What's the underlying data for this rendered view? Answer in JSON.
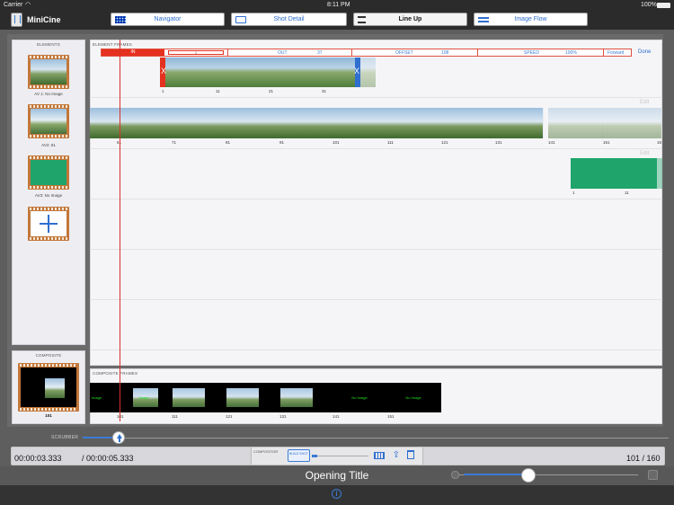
{
  "status": {
    "carrier": "Carrier",
    "time": "8:11 PM",
    "battery": "100%"
  },
  "app": {
    "title": "MiniCine"
  },
  "tabs": [
    {
      "label": "Navigator",
      "icon": "grid-icon"
    },
    {
      "label": "Shot Detail",
      "icon": "play-box-icon"
    },
    {
      "label": "Line Up",
      "icon": "lineup-icon",
      "active": true
    },
    {
      "label": "Image Flow",
      "icon": "flow-icon"
    }
  ],
  "elements": {
    "caption": "ELEMENTS",
    "items": [
      {
        "caption": "AV 1: No Image",
        "kind": "landscape"
      },
      {
        "caption": "AV2: 61",
        "kind": "landscape"
      },
      {
        "caption": "AV3: No Image",
        "kind": "green"
      },
      {
        "caption": "",
        "kind": "add"
      }
    ]
  },
  "composite": {
    "caption": "COMPOSITE",
    "frame": "101"
  },
  "elementFrames": {
    "caption": "ELEMENT FRAMES",
    "controls": {
      "in_label": "IN",
      "in_value": "1",
      "out_label": "OUT",
      "out_value": "37",
      "offset_label": "OFFSET",
      "offset_value": "108",
      "speed_label": "SPEED",
      "speed_value": "100%",
      "direction": "Forward",
      "done": "Done"
    },
    "track1": {
      "ticks": [
        "1",
        "11",
        "21",
        "31"
      ],
      "x_left": "X",
      "x_right": "X"
    },
    "track2": {
      "ticks": [
        "61",
        "71",
        "81",
        "91",
        "101",
        "111",
        "121",
        "131",
        "141",
        "151",
        "16"
      ],
      "edit": "Edit"
    },
    "track3": {
      "ticks": [
        "1",
        "11"
      ],
      "edit": "Edit"
    }
  },
  "compositeFrames": {
    "caption": "COMPOSITE FRAMES",
    "cells": [
      {
        "text": "Image",
        "tick": "101"
      },
      {
        "text": "Image",
        "tick": "111"
      },
      {
        "text": "",
        "tick": "121"
      },
      {
        "text": "",
        "tick": "131"
      },
      {
        "text": "No Image",
        "tick": "141"
      },
      {
        "text": "No Image",
        "tick": "151"
      }
    ]
  },
  "scrubber": {
    "label": "SCRUBBER"
  },
  "timebar": {
    "current": "00:00:03.333",
    "total": "/ 00:00:05.333",
    "frames": "101 / 160",
    "compositor_label": "COMPOSITOR",
    "build_label": "BUILD SHOT"
  },
  "shot": {
    "title": "Opening Title"
  }
}
